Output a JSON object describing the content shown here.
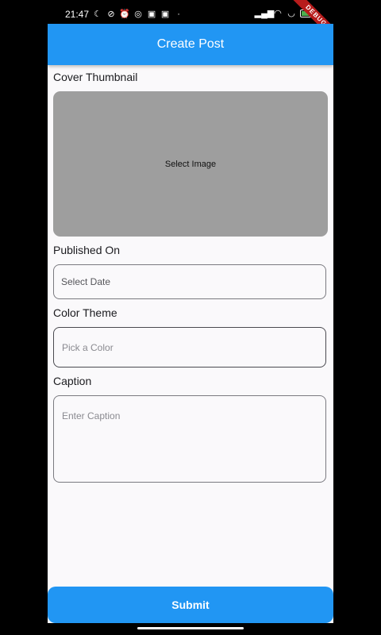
{
  "status_bar": {
    "time": "21:47",
    "left_icons": [
      "moon-icon",
      "mute-icon",
      "alarm-icon",
      "whatsapp-icon",
      "game-icon",
      "game-icon-2",
      "dot-icon"
    ],
    "battery_level": "100"
  },
  "debug_banner": "DEBUG",
  "app_bar": {
    "title": "Create Post"
  },
  "form": {
    "cover_label": "Cover Thumbnail",
    "cover_button": "Select Image",
    "published_label": "Published On",
    "published_placeholder": "Select Date",
    "color_label": "Color Theme",
    "color_placeholder": "Pick a Color",
    "caption_label": "Caption",
    "caption_placeholder": "Enter Caption"
  },
  "submit_label": "Submit",
  "colors": {
    "primary": "#2196f3",
    "background": "#faf9fb",
    "thumbnail": "#9e9e9e"
  }
}
